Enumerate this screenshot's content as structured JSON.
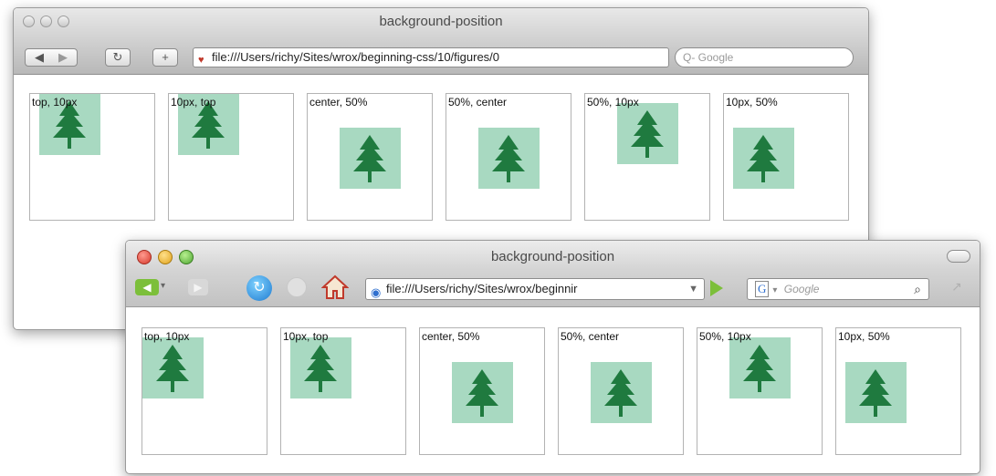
{
  "back_window": {
    "title": "background-position",
    "toolbar": {
      "back_icon": "back-arrow-icon",
      "forward_icon": "forward-arrow-icon",
      "reload_icon": "reload-icon",
      "add_bookmark_label": "+",
      "address": "file:///Users/richy/Sites/wrox/beginning-css/10/figures/0",
      "search_placeholder": "Q- Google"
    },
    "boxes": [
      {
        "label": "top, 10px"
      },
      {
        "label": "10px, top"
      },
      {
        "label": "center, 50%"
      },
      {
        "label": "50%, center"
      },
      {
        "label": "50%, 10px"
      },
      {
        "label": "10px, 50%"
      }
    ]
  },
  "front_window": {
    "title": "background-position",
    "toolbar": {
      "back_icon": "back-arrow-icon",
      "forward_icon": "forward-arrow-icon",
      "reload_icon": "reload-icon",
      "stop_icon": "stop-icon",
      "home_icon": "home-icon",
      "address": "file:///Users/richy/Sites/wrox/beginnir",
      "go_icon": "go-arrow-icon",
      "search_placeholder": "Google",
      "search_engine_label": "G"
    },
    "boxes": [
      {
        "label": "top, 10px"
      },
      {
        "label": "10px, top"
      },
      {
        "label": "center, 50%"
      },
      {
        "label": "50%, center"
      },
      {
        "label": "50%, 10px"
      },
      {
        "label": "10px, 50%"
      }
    ]
  },
  "colors": {
    "tree_background": "#a8d9c1",
    "tree_green": "#1f7a3f"
  }
}
